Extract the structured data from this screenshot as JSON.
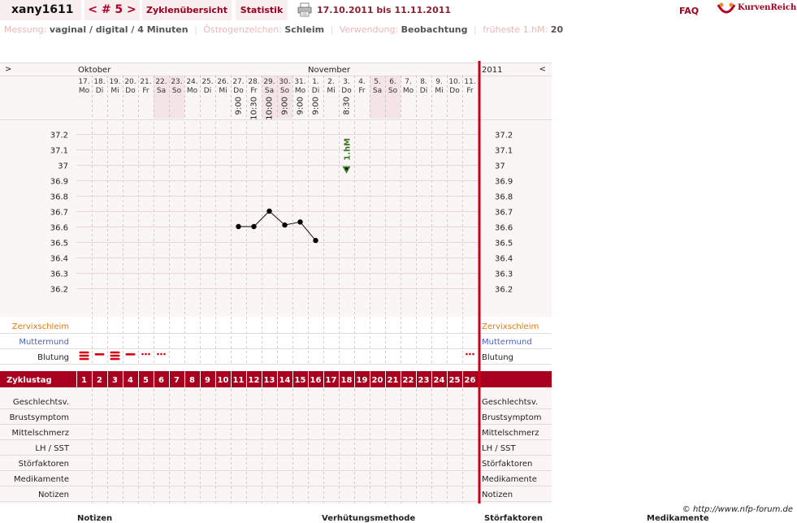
{
  "header": {
    "username": "xany1611",
    "cycle_nav": "< # 5 >",
    "tabs": [
      "Zyklenübersicht",
      "Statistik"
    ],
    "date_range": "17.10.2011 bis 11.11.2011",
    "faq": "FAQ",
    "brand": "KurvenReich"
  },
  "info": {
    "messung_label": "Messung:",
    "messung_value": "vaginal / digital / 4 Minuten",
    "oestrogen_label": "Östrogenzeichen:",
    "oestrogen_value": "Schleim",
    "verwendung_label": "Verwendung:",
    "verwendung_value": "Beobachtung",
    "hm_label": "früheste 1.hM:",
    "hm_value": "20"
  },
  "calendar": {
    "nav_left": ">",
    "nav_right": "<",
    "month1": "Oktober",
    "month2": "November",
    "year": "2011",
    "dates": [
      "17.",
      "18.",
      "19.",
      "20.",
      "21.",
      "22.",
      "23.",
      "24.",
      "25.",
      "26.",
      "27.",
      "28.",
      "29.",
      "30.",
      "31.",
      "1.",
      "2.",
      "3.",
      "4.",
      "5.",
      "6.",
      "7.",
      "8.",
      "9.",
      "10.",
      "11."
    ],
    "weekdays": [
      "Mo",
      "Di",
      "Mi",
      "Do",
      "Fr",
      "Sa",
      "So",
      "Mo",
      "Di",
      "Mi",
      "Do",
      "Fr",
      "Sa",
      "So",
      "Mo",
      "Di",
      "Mi",
      "Do",
      "Fr",
      "Sa",
      "So",
      "Mo",
      "Di",
      "Mi",
      "Do",
      "Fr"
    ],
    "weekend_days": [
      6,
      7,
      13,
      14,
      20,
      21
    ],
    "times": [
      "",
      "",
      "",
      "",
      "",
      "",
      "",
      "",
      "",
      "",
      "9:00",
      "10:30",
      "10:00",
      "9:00",
      "9:00",
      "9:00",
      "",
      "8:30",
      "",
      "",
      "",
      "",
      "",
      "",
      "",
      ""
    ]
  },
  "chart_data": {
    "type": "line",
    "title": "",
    "xlabel": "",
    "ylabel": "",
    "ylim": [
      36.1,
      37.3
    ],
    "y_ticks": [
      "37.2",
      "37.1",
      "37",
      "36.9",
      "36.8",
      "36.7",
      "36.6",
      "36.5",
      "36.4",
      "36.3",
      "36.2"
    ],
    "series": [
      {
        "x": [
          11,
          12,
          13,
          14,
          15,
          16
        ],
        "values": [
          36.6,
          36.6,
          36.7,
          36.61,
          36.63,
          36.51
        ]
      }
    ],
    "marker_label": "1.hM",
    "marker_day": 18,
    "marker_value": 36.97
  },
  "rows": {
    "zervix": "Zervixschleim",
    "muttermund": "Muttermund",
    "blutung": "Blutung",
    "zyklustag": "Zyklustag",
    "cycle_days": [
      "1",
      "2",
      "3",
      "4",
      "5",
      "6",
      "7",
      "8",
      "9",
      "10",
      "11",
      "12",
      "13",
      "14",
      "15",
      "16",
      "17",
      "18",
      "19",
      "20",
      "21",
      "22",
      "23",
      "24",
      "25",
      "26"
    ],
    "bleeding": [
      [
        1,
        "heavy"
      ],
      [
        2,
        "medium"
      ],
      [
        3,
        "heavy"
      ],
      [
        4,
        "medium"
      ],
      [
        5,
        "light"
      ],
      [
        6,
        "light"
      ],
      [
        26,
        "light"
      ]
    ],
    "bottom": [
      "Geschlechtsv.",
      "Brustsymptom",
      "Mittelschmerz",
      "LH / SST",
      "Störfaktoren",
      "Medikamente",
      "Notizen"
    ]
  },
  "footer": {
    "copyright": "© http://www.nfp-forum.de",
    "headers": [
      "Notizen",
      "Verhütungsmethode",
      "Störfaktoren",
      "Medikamente"
    ]
  },
  "colors": {
    "accent": "#b0002a",
    "zyklus_bar": "#a8001e",
    "weekend": "#f4e4e6",
    "panel": "#fbf6f6",
    "zervix_label": "#e07a10",
    "muttermund_label": "#4a5fc8",
    "marker": "#3e7a2a"
  }
}
